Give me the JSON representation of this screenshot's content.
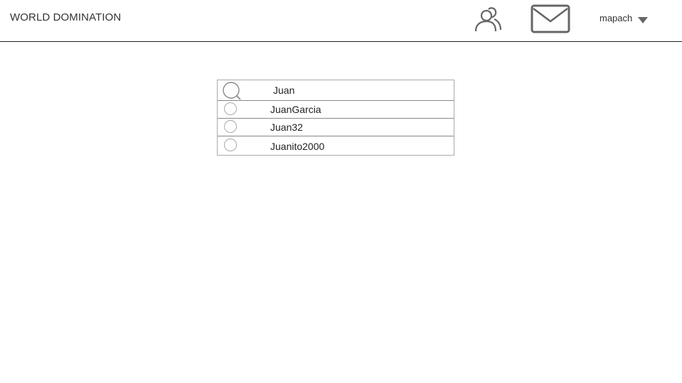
{
  "header": {
    "title": "WORLD DOMINATION",
    "icons": {
      "friends": "users-icon",
      "messages": "mail-icon",
      "menu": "caret-down-icon"
    },
    "username": "mapach"
  },
  "search": {
    "icon": "search-icon",
    "value": "Juan",
    "results": [
      {
        "label": "JuanGarcia"
      },
      {
        "label": "Juan32"
      },
      {
        "label": "Juanito2000"
      }
    ]
  },
  "colors": {
    "icon_gray": "#666666",
    "border": "#aaaaaa",
    "divider": "#222222"
  }
}
